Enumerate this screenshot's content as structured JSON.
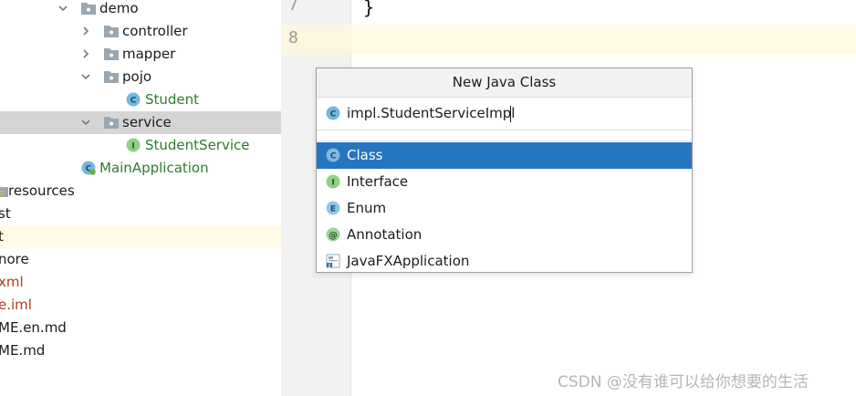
{
  "tree": {
    "items": [
      {
        "label": "demo"
      },
      {
        "label": "controller"
      },
      {
        "label": "mapper"
      },
      {
        "label": "pojo"
      },
      {
        "label": "Student"
      },
      {
        "label": "service"
      },
      {
        "label": "StudentService"
      },
      {
        "label": "MainApplication"
      },
      {
        "label": "resources"
      },
      {
        "label": "st"
      },
      {
        "label": "t"
      },
      {
        "label": "nore"
      },
      {
        "label": "xml"
      },
      {
        "label": "e.iml"
      },
      {
        "label": "ME.en.md"
      },
      {
        "label": "ME.md"
      }
    ]
  },
  "editor": {
    "line_numbers": [
      "7",
      "8"
    ],
    "code_line_7": "}"
  },
  "dialog": {
    "title": "New Java Class",
    "name_value": "impl.StudentServiceImpl",
    "kinds": [
      {
        "label": "Class",
        "icon": "class-icon"
      },
      {
        "label": "Interface",
        "icon": "interface-icon"
      },
      {
        "label": "Enum",
        "icon": "enum-icon"
      },
      {
        "label": "Annotation",
        "icon": "annotation-icon"
      },
      {
        "label": "JavaFXApplication",
        "icon": "javafx-icon"
      }
    ],
    "selected_kind": "Class"
  },
  "watermark": "CSDN @没有谁可以给你想要的生活",
  "colors": {
    "selection": "#2675bf",
    "tree_selected": "#d5d5d5",
    "caret_line": "#fffae3",
    "class_name_green": "#2d7c2d"
  }
}
